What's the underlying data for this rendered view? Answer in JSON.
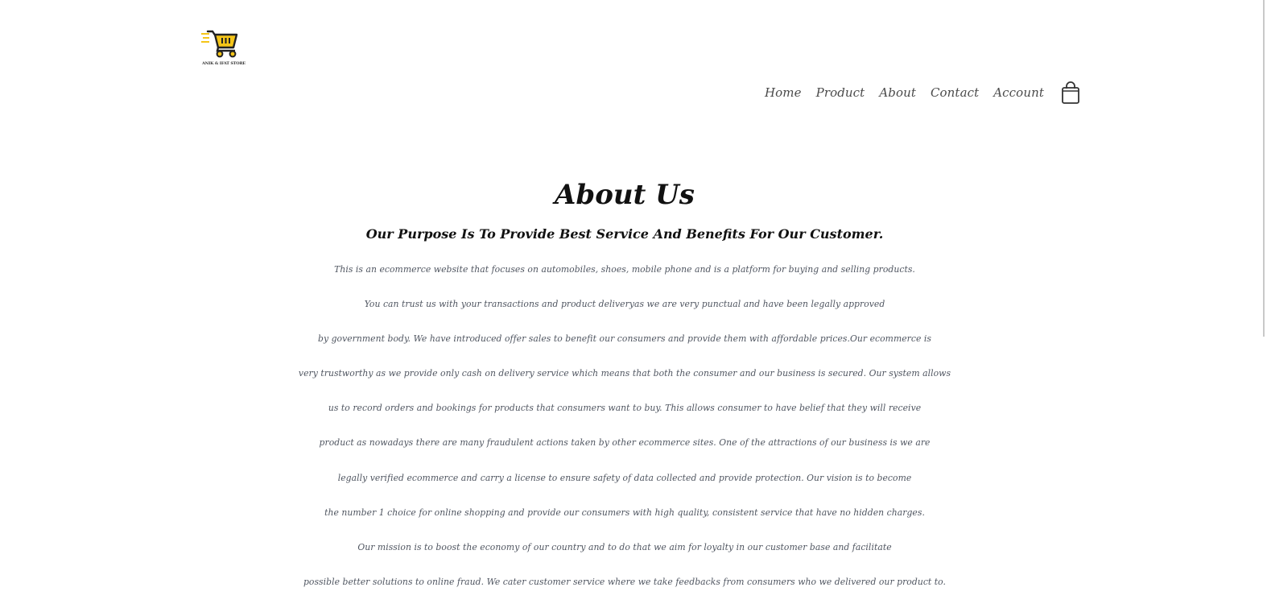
{
  "header": {
    "logo": {
      "icon": "shopping-cart-icon",
      "text": "ANIK & IFAT STORE",
      "accent_color": "#f5c518"
    },
    "nav": [
      {
        "label": "Home"
      },
      {
        "label": "Product"
      },
      {
        "label": "About"
      },
      {
        "label": "Contact"
      },
      {
        "label": "Account"
      }
    ],
    "cart_icon": "shopping-bag-icon"
  },
  "about": {
    "title": "About Us",
    "subtitle": "Our Purpose Is To Provide Best Service And Benefits For Our Customer.",
    "lines": [
      "This is an ecommerce website that focuses on automobiles, shoes, mobile phone and is a platform for buying and selling products.",
      "You can trust us with your transactions and product deliveryas we are very punctual and have been legally approved",
      "by government body. We have introduced offer sales to benefit our consumers and provide them with affordable prices.Our ecommerce is",
      "very trustworthy as we provide only cash on delivery service which means that both the consumer and our business is secured. Our system allows",
      "us to record orders and bookings for products that consumers want to buy. This allows consumer to have belief that they will receive",
      "product as nowadays there are many fraudulent actions taken by other ecommerce sites. One of the attractions of our business is we are",
      "legally verified ecommerce and carry a license to ensure safety of data collected and provide protection. Our vision is to become",
      "the number 1 choice for online shopping and provide our consumers with high quality, consistent service that have no hidden charges.",
      "Our mission is to boost the economy of our country and to do that we aim for loyalty in our customer base and facilitate",
      "possible better solutions to online fraud. We cater customer service where we take feedbacks from consumers who we delivered our product to."
    ]
  }
}
